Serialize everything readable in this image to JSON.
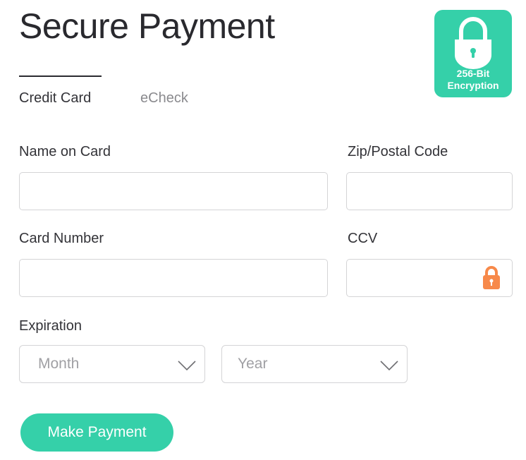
{
  "header": {
    "title": "Secure Payment"
  },
  "badge": {
    "line1": "256-Bit",
    "line2": "Encryption",
    "color": "#35d0a9"
  },
  "tabs": [
    {
      "label": "Credit Card",
      "active": true
    },
    {
      "label": "eCheck",
      "active": false
    }
  ],
  "form": {
    "name_on_card": {
      "label": "Name on Card",
      "value": "",
      "placeholder": ""
    },
    "zip": {
      "label": "Zip/Postal Code",
      "value": "",
      "placeholder": ""
    },
    "card_number": {
      "label": "Card Number",
      "value": "",
      "placeholder": ""
    },
    "ccv": {
      "label": "CCV",
      "value": "",
      "placeholder": "",
      "icon": "lock-icon",
      "icon_color": "#f7894a"
    },
    "expiration": {
      "label": "Expiration",
      "month": {
        "selected": "Month"
      },
      "year": {
        "selected": "Year"
      }
    }
  },
  "submit": {
    "label": "Make Payment",
    "color": "#35d0a9"
  }
}
